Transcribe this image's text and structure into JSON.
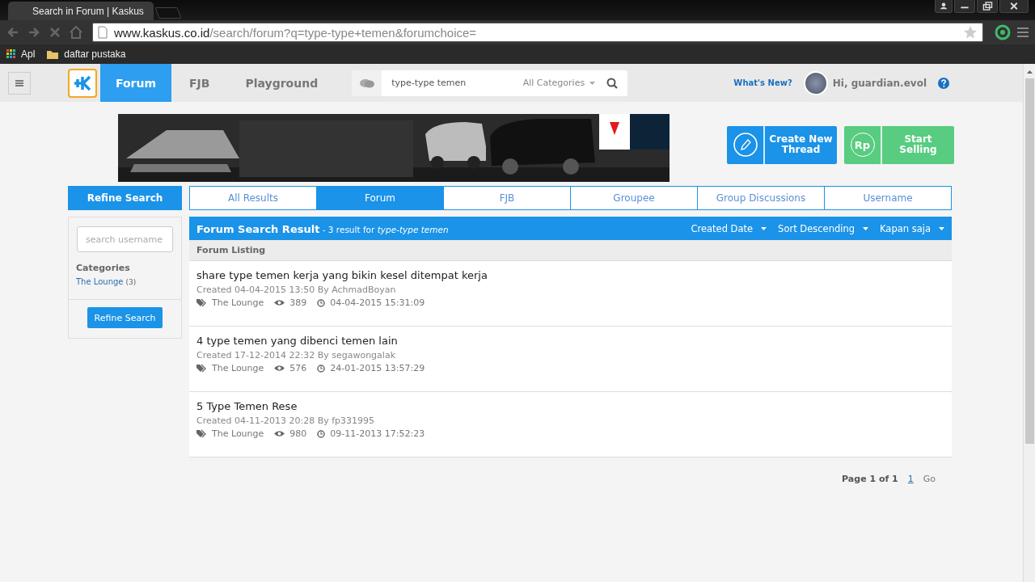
{
  "browser": {
    "tab_title": "Search in Forum | Kaskus",
    "url_host": "www.kaskus.co.id",
    "url_path": "/search/forum?q=type-type+temen&forumchoice=",
    "bookmarks": [
      {
        "label": "Apl",
        "kind": "apps"
      },
      {
        "label": "daftar pustaka",
        "kind": "folder"
      }
    ]
  },
  "header": {
    "nav": [
      {
        "label": "Forum",
        "selected": true
      },
      {
        "label": "FJB",
        "selected": false
      },
      {
        "label": "Playground",
        "selected": false
      }
    ],
    "search": {
      "value": "type-type temen",
      "category": "All Categories"
    },
    "whats_new": "What's New?",
    "greeting": "Hi, guardian.evol"
  },
  "actions": [
    {
      "label": "Create New Thread",
      "kind": "thread"
    },
    {
      "label": "Start Selling",
      "kind": "sell",
      "icon_text": "Rp"
    }
  ],
  "sidebar": {
    "title": "Refine Search",
    "username_placeholder": "search username",
    "categories_heading": "Categories",
    "categories": [
      {
        "name": "The Lounge",
        "count": "(3)"
      }
    ],
    "button": "Refine Search"
  },
  "tabs": [
    {
      "label": "All Results",
      "selected": false
    },
    {
      "label": "Forum",
      "selected": true
    },
    {
      "label": "FJB",
      "selected": false
    },
    {
      "label": "Groupee",
      "selected": false
    },
    {
      "label": "Group Discussions",
      "selected": false
    },
    {
      "label": "Username",
      "selected": false
    }
  ],
  "results": {
    "title": "Forum Search Result",
    "summary": "- 3 result for *type-type temen*",
    "sorts": [
      "Created Date",
      "Sort Descending",
      "Kapan saja"
    ],
    "listing_heading": "Forum Listing",
    "rows": [
      {
        "title": "share type temen kerja yang bikin kesel ditempat kerja",
        "meta": "Created 04-04-2015 13:50 By AchmadBoyan",
        "category": "The Lounge",
        "views": "389",
        "last": "04-04-2015 15:31:09"
      },
      {
        "title": "4 type temen yang dibenci temen lain",
        "meta": "Created 17-12-2014 22:32 By segawongalak",
        "category": "The Lounge",
        "views": "576",
        "last": "24-01-2015 13:57:29"
      },
      {
        "title": "5 Type Temen Rese",
        "meta": "Created 04-11-2013 20:28 By fp331995",
        "category": "The Lounge",
        "views": "980",
        "last": "09-11-2013 17:52:23"
      }
    ]
  },
  "pagination": {
    "label": "Page 1 of 1",
    "pages": [
      {
        "label": "1",
        "selected": true
      }
    ],
    "go": "Go"
  }
}
